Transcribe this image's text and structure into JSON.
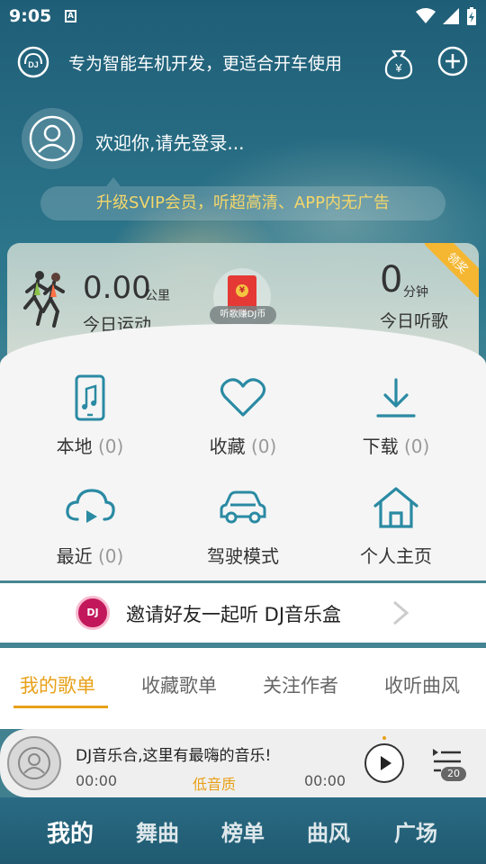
{
  "status_bar": {
    "time": "9:05",
    "notification_glyph": "A"
  },
  "header": {
    "slogan": "专为智能车机开发，更适合开车使用"
  },
  "profile": {
    "login_prompt": "欢迎你,请先登录...",
    "svip_banner": "升级SVIP会员，听超高清、APP内无广告"
  },
  "stats": {
    "exercise_value": "0.00",
    "exercise_unit": "公里",
    "exercise_label": "今日运动",
    "earn_label": "听歌赚DJ币",
    "listen_value": "0",
    "listen_unit": "分钟",
    "listen_label": "今日听歌",
    "ribbon_label": "领奖"
  },
  "grid": {
    "items": [
      {
        "label": "本地",
        "count": "(0)",
        "icon": "phone-music-icon"
      },
      {
        "label": "收藏",
        "count": "(0)",
        "icon": "heart-icon"
      },
      {
        "label": "下载",
        "count": "(0)",
        "icon": "download-icon"
      },
      {
        "label": "最近",
        "count": "(0)",
        "icon": "cloud-play-icon"
      },
      {
        "label": "驾驶模式",
        "count": "",
        "icon": "car-icon"
      },
      {
        "label": "个人主页",
        "count": "",
        "icon": "home-icon"
      }
    ]
  },
  "invite": {
    "logo_text": "DJ",
    "text": "邀请好友一起听 DJ音乐盒"
  },
  "tabs": [
    {
      "label": "我的歌单",
      "active": true
    },
    {
      "label": "收藏歌单",
      "active": false
    },
    {
      "label": "关注作者",
      "active": false
    },
    {
      "label": "收听曲风",
      "active": false
    }
  ],
  "player": {
    "title": "DJ音乐合,这里有最嗨的音乐!",
    "time_current": "00:00",
    "quality": "低音质",
    "time_total": "00:00",
    "queue_count": "20"
  },
  "bottom_nav": [
    {
      "label": "我的",
      "active": true
    },
    {
      "label": "舞曲",
      "active": false
    },
    {
      "label": "榜单",
      "active": false
    },
    {
      "label": "曲风",
      "active": false
    },
    {
      "label": "广场",
      "active": false
    }
  ],
  "colors": {
    "accent": "#e8a11a",
    "icon_teal": "#2a8aa3",
    "svip_gold": "#f5d76a"
  }
}
